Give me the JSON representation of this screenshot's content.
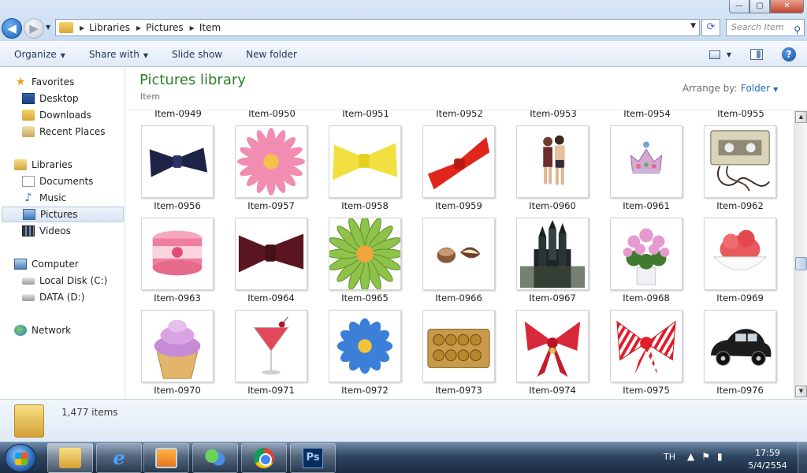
{
  "window": {
    "minimize_glyph": "—",
    "maximize_glyph": "▢",
    "close_glyph": "✕"
  },
  "address": {
    "crumbs": [
      "Libraries",
      "Pictures",
      "Item"
    ],
    "search_placeholder": "Search Item"
  },
  "commands": {
    "organize": "Organize",
    "share_with": "Share with",
    "slide_show": "Slide show",
    "new_folder": "New folder"
  },
  "nav": {
    "favorites": "Favorites",
    "desktop": "Desktop",
    "downloads": "Downloads",
    "recent_places": "Recent Places",
    "libraries": "Libraries",
    "documents": "Documents",
    "music": "Music",
    "pictures": "Pictures",
    "videos": "Videos",
    "computer": "Computer",
    "local_disk": "Local Disk (C:)",
    "data_disk": "DATA (D:)",
    "network": "Network"
  },
  "library": {
    "title": "Pictures library",
    "subtitle": "Item",
    "arrange_label": "Arrange by:",
    "arrange_value": "Folder"
  },
  "top_row_labels": [
    "Item-0949",
    "Item-0950",
    "Item-0951",
    "Item-0952",
    "Item-0953",
    "Item-0954",
    "Item-0955"
  ],
  "items": [
    {
      "label": "Item-0956",
      "subject": "navy bow tie"
    },
    {
      "label": "Item-0957",
      "subject": "pink flower"
    },
    {
      "label": "Item-0958",
      "subject": "yellow bow tie"
    },
    {
      "label": "Item-0959",
      "subject": "red bow tie"
    },
    {
      "label": "Item-0960",
      "subject": "couple"
    },
    {
      "label": "Item-0961",
      "subject": "crown"
    },
    {
      "label": "Item-0962",
      "subject": "cassette"
    },
    {
      "label": "Item-0963",
      "subject": "pink tub"
    },
    {
      "label": "Item-0964",
      "subject": "maroon bow tie"
    },
    {
      "label": "Item-0965",
      "subject": "green flower"
    },
    {
      "label": "Item-0966",
      "subject": "chocolates"
    },
    {
      "label": "Item-0967",
      "subject": "castle"
    },
    {
      "label": "Item-0968",
      "subject": "flower pot"
    },
    {
      "label": "Item-0969",
      "subject": "ice cream"
    },
    {
      "label": "Item-0970",
      "subject": "cupcake"
    },
    {
      "label": "Item-0971",
      "subject": "cocktail"
    },
    {
      "label": "Item-0972",
      "subject": "blue flower"
    },
    {
      "label": "Item-0973",
      "subject": "chocolate box"
    },
    {
      "label": "Item-0974",
      "subject": "red ribbon bow"
    },
    {
      "label": "Item-0975",
      "subject": "striped bow"
    },
    {
      "label": "Item-0976",
      "subject": "vintage car"
    }
  ],
  "details": {
    "count": "1,477 items"
  },
  "taskbar": {
    "ps_label": "Ps",
    "ie_label": "e",
    "language": "TH",
    "time": "17:59",
    "date": "5/4/2554"
  },
  "colors": {
    "library_title": "#2b7f2b",
    "link_blue": "#1f6ac6",
    "taskbar": "#2e4560"
  }
}
